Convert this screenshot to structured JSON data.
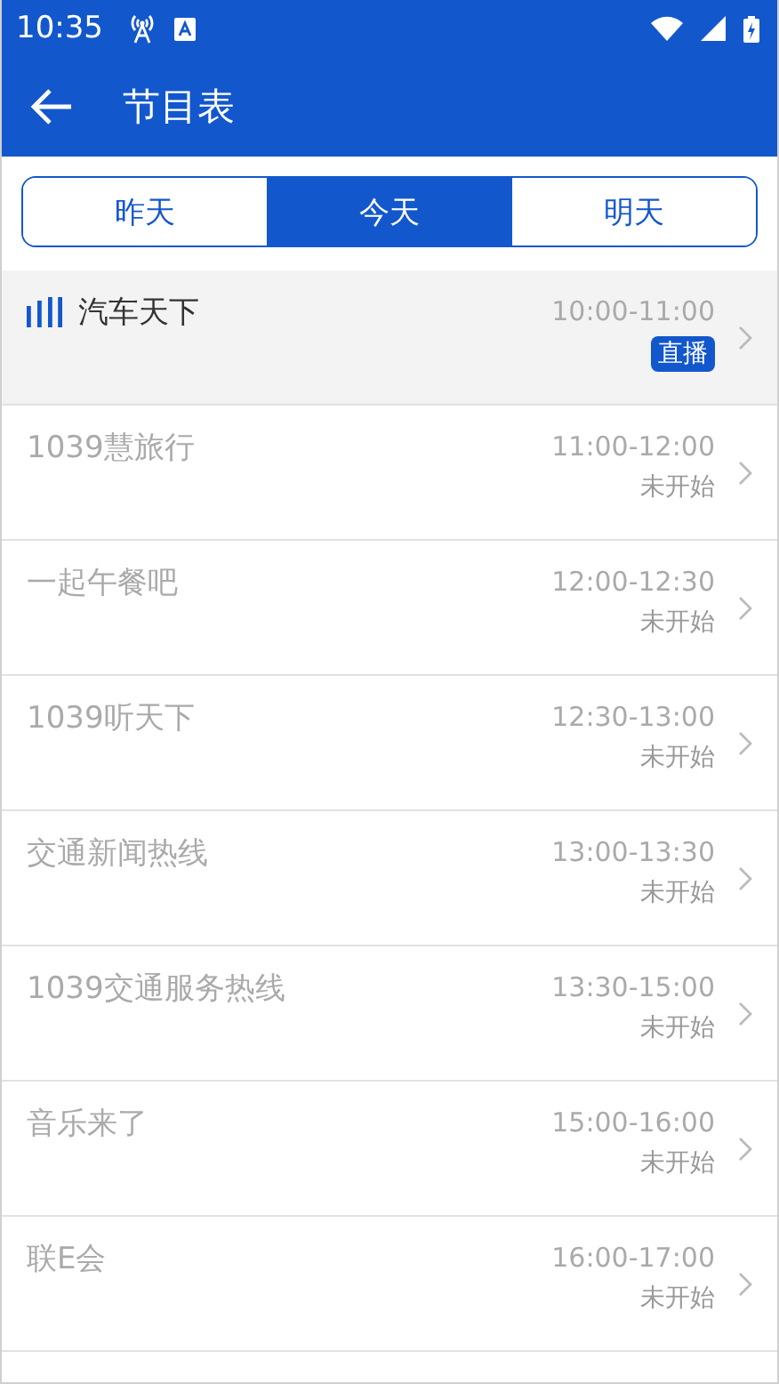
{
  "status_bar": {
    "time": "10:35"
  },
  "app_bar": {
    "title": "节目表"
  },
  "tabs": [
    {
      "label": "昨天",
      "selected": false
    },
    {
      "label": "今天",
      "selected": true
    },
    {
      "label": "明天",
      "selected": false
    }
  ],
  "programs": [
    {
      "name": "汽车天下",
      "time": "10:00-11:00",
      "status": "直播",
      "kind": "live",
      "playing": true
    },
    {
      "name": "1039慧旅行",
      "time": "11:00-12:00",
      "status": "未开始",
      "kind": "pending",
      "playing": false
    },
    {
      "name": "一起午餐吧",
      "time": "12:00-12:30",
      "status": "未开始",
      "kind": "pending",
      "playing": false
    },
    {
      "name": "1039听天下",
      "time": "12:30-13:00",
      "status": "未开始",
      "kind": "pending",
      "playing": false
    },
    {
      "name": "交通新闻热线",
      "time": "13:00-13:30",
      "status": "未开始",
      "kind": "pending",
      "playing": false
    },
    {
      "name": "1039交通服务热线",
      "time": "13:30-15:00",
      "status": "未开始",
      "kind": "pending",
      "playing": false
    },
    {
      "name": "音乐来了",
      "time": "15:00-16:00",
      "status": "未开始",
      "kind": "pending",
      "playing": false
    },
    {
      "name": "联E会",
      "time": "16:00-17:00",
      "status": "未开始",
      "kind": "pending",
      "playing": false
    }
  ]
}
